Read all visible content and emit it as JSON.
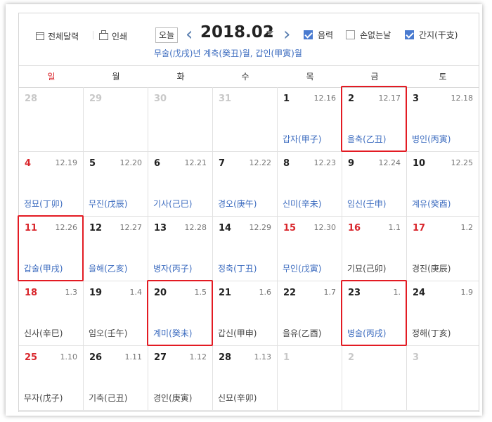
{
  "toolbar": {
    "full_calendar": "전체달력",
    "print": "인쇄",
    "today": "오늘",
    "month_title": "2018.02",
    "prev": "‹",
    "next": "›",
    "lunar_label": "음력",
    "lunar_checked": true,
    "nohand_label": "손없는날",
    "nohand_checked": false,
    "ganji_label": "간지(干支)",
    "ganji_checked": true,
    "ganji_line": "무술(戊戌)년 계축(癸丑)월, 갑인(甲寅)월"
  },
  "weekdays": [
    "일",
    "월",
    "화",
    "수",
    "목",
    "금",
    "토"
  ],
  "weeks": [
    [
      {
        "d": "28",
        "l": "",
        "g": "",
        "t": "dim"
      },
      {
        "d": "29",
        "l": "",
        "g": "",
        "t": "dim"
      },
      {
        "d": "30",
        "l": "",
        "g": "",
        "t": "dim"
      },
      {
        "d": "31",
        "l": "",
        "g": "",
        "t": "dim"
      },
      {
        "d": "1",
        "l": "12.16",
        "g": "갑자(甲子)",
        "t": ""
      },
      {
        "d": "2",
        "l": "12.17",
        "g": "을축(乙丑)",
        "t": ""
      },
      {
        "d": "3",
        "l": "12.18",
        "g": "병인(丙寅)",
        "t": ""
      }
    ],
    [
      {
        "d": "4",
        "l": "12.19",
        "g": "정묘(丁卯)",
        "t": "red"
      },
      {
        "d": "5",
        "l": "12.20",
        "g": "무진(戊辰)",
        "t": ""
      },
      {
        "d": "6",
        "l": "12.21",
        "g": "기사(己巳)",
        "t": ""
      },
      {
        "d": "7",
        "l": "12.22",
        "g": "경오(庚午)",
        "t": ""
      },
      {
        "d": "8",
        "l": "12.23",
        "g": "신미(辛未)",
        "t": ""
      },
      {
        "d": "9",
        "l": "12.24",
        "g": "임신(壬申)",
        "t": ""
      },
      {
        "d": "10",
        "l": "12.25",
        "g": "계유(癸酉)",
        "t": ""
      }
    ],
    [
      {
        "d": "11",
        "l": "12.26",
        "g": "갑술(甲戌)",
        "t": "red"
      },
      {
        "d": "12",
        "l": "12.27",
        "g": "을해(乙亥)",
        "t": ""
      },
      {
        "d": "13",
        "l": "12.28",
        "g": "병자(丙子)",
        "t": ""
      },
      {
        "d": "14",
        "l": "12.29",
        "g": "정축(丁丑)",
        "t": ""
      },
      {
        "d": "15",
        "l": "12.30",
        "g": "무인(戊寅)",
        "t": "red"
      },
      {
        "d": "16",
        "l": "1.1",
        "g": "기묘(己卯)",
        "t": "red",
        "gd": "dark"
      },
      {
        "d": "17",
        "l": "1.2",
        "g": "경진(庚辰)",
        "t": "red",
        "gd": "dark"
      }
    ],
    [
      {
        "d": "18",
        "l": "1.3",
        "g": "신사(辛巳)",
        "t": "red",
        "gd": "dark"
      },
      {
        "d": "19",
        "l": "1.4",
        "g": "임오(壬午)",
        "t": "",
        "gd": "dark"
      },
      {
        "d": "20",
        "l": "1.5",
        "g": "계미(癸未)",
        "t": ""
      },
      {
        "d": "21",
        "l": "1.6",
        "g": "갑신(甲申)",
        "t": "",
        "gd": "dark"
      },
      {
        "d": "22",
        "l": "1.7",
        "g": "을유(乙酉)",
        "t": "",
        "gd": "dark"
      },
      {
        "d": "23",
        "l": "1.",
        "g": "병술(丙戌)",
        "t": ""
      },
      {
        "d": "24",
        "l": "1.9",
        "g": "정해(丁亥)",
        "t": "",
        "gd": "dark"
      }
    ],
    [
      {
        "d": "25",
        "l": "1.10",
        "g": "무자(戊子)",
        "t": "red",
        "gd": "dark"
      },
      {
        "d": "26",
        "l": "1.11",
        "g": "기축(己丑)",
        "t": "",
        "gd": "dark"
      },
      {
        "d": "27",
        "l": "1.12",
        "g": "경인(庚寅)",
        "t": "",
        "gd": "dark"
      },
      {
        "d": "28",
        "l": "1.13",
        "g": "신묘(辛卯)",
        "t": "",
        "gd": "dark"
      },
      {
        "d": "1",
        "l": "",
        "g": "",
        "t": "dim"
      },
      {
        "d": "2",
        "l": "",
        "g": "",
        "t": "dim"
      },
      {
        "d": "3",
        "l": "",
        "g": "",
        "t": "dim"
      }
    ]
  ],
  "highlights": [
    {
      "week": 0,
      "day": 5
    },
    {
      "week": 2,
      "day": 0
    },
    {
      "week": 3,
      "day": 2
    },
    {
      "week": 3,
      "day": 5
    }
  ],
  "colors": {
    "highlight": "#e31b23",
    "link": "#3b6bbf",
    "sunday": "#d9262c"
  }
}
